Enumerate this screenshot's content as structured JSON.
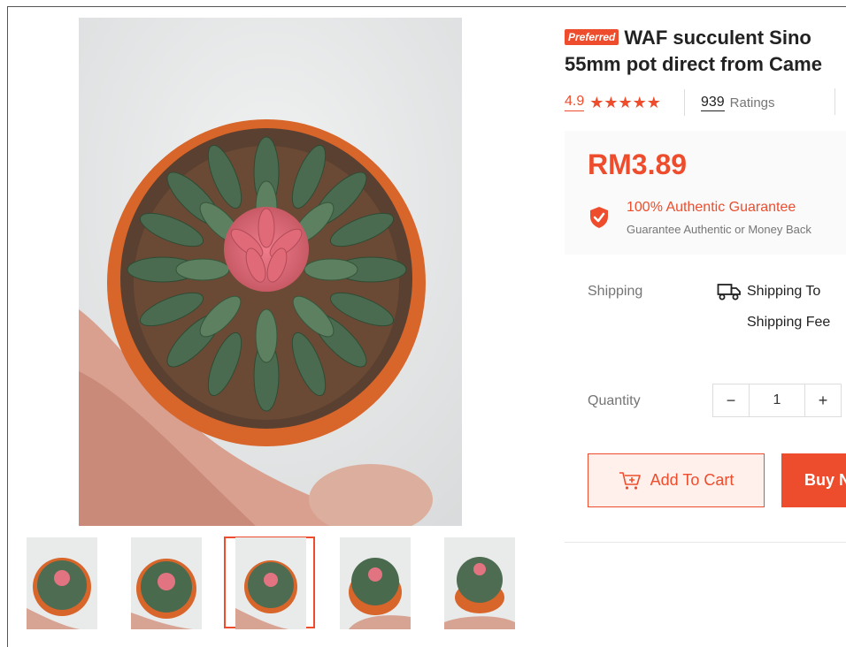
{
  "product": {
    "badge": "Preferred",
    "title_line1": "WAF succulent Sino",
    "title_line2": "55mm pot direct from Came",
    "rating": "4.9",
    "stars": "★★★★★",
    "ratings_count": "939",
    "ratings_label": "Ratings",
    "price": "RM3.89",
    "guarantee_title": "100% Authentic Guarantee",
    "guarantee_subtitle": "Guarantee Authentic or Money Back"
  },
  "shipping": {
    "label": "Shipping",
    "to": "Shipping To",
    "fee": "Shipping Fee"
  },
  "quantity": {
    "label": "Quantity",
    "minus": "−",
    "value": "1",
    "plus": "+"
  },
  "actions": {
    "add_to_cart": "Add To Cart",
    "buy_now": "Buy N"
  },
  "gallery": {
    "selected_index": 2,
    "thumbnail_count": 5
  },
  "colors": {
    "accent": "#ee4d2d",
    "accent_light": "#fff0ec",
    "panel_bg": "#fafafa"
  },
  "icons": {
    "stars": "star-icon",
    "shield": "shield-check-icon",
    "truck": "truck-icon",
    "cart": "cart-plus-icon"
  }
}
